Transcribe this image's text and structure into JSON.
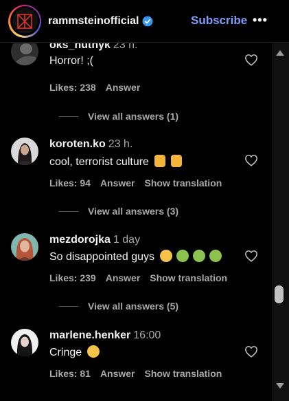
{
  "header": {
    "username": "rammsteinofficial",
    "subscribe_label": "Subscribe",
    "more_label": "•••"
  },
  "comments": [
    {
      "user": "oks_nutnyk",
      "time": "23 h.",
      "text": "Horror! ;(",
      "likes": "Likes: 238",
      "answer": "Answer",
      "translation": "",
      "view_answers": "View all answers (1)"
    },
    {
      "user": "koroten.ko",
      "time": "23 h.",
      "text": "cool, terrorist culture",
      "likes": "Likes: 94",
      "answer": "Answer",
      "translation": "Show translation",
      "view_answers": "View all answers (3)"
    },
    {
      "user": "mezdorojka",
      "time": "1 day",
      "text": "So disappointed guys",
      "likes": "Likes: 239",
      "answer": "Answer",
      "translation": "Show translation",
      "view_answers": "View all answers (5)"
    },
    {
      "user": "marlene.henker",
      "time": "16:00",
      "text": "Cringe",
      "likes": "Likes: 81",
      "answer": "Answer",
      "translation": "Show translation",
      "view_answers": ""
    }
  ],
  "colors": {
    "accent": "#7f9df8",
    "verified": "#3897f0",
    "muted": "#a8a8a8"
  }
}
